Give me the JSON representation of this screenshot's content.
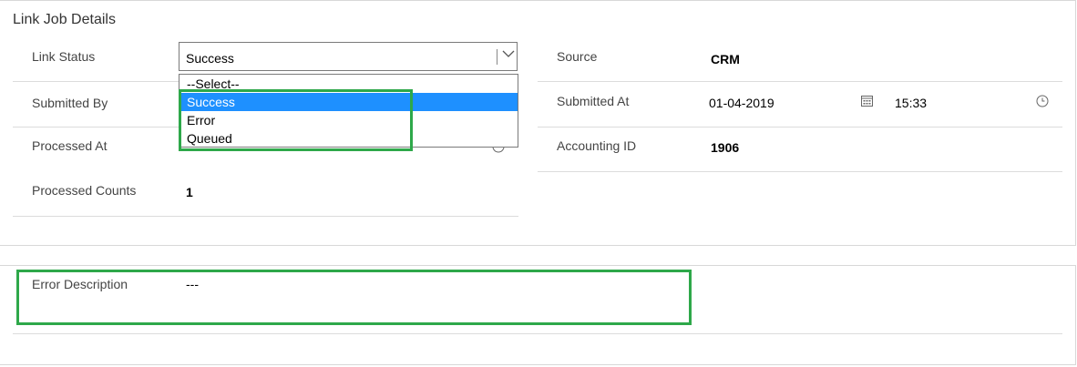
{
  "link_job": {
    "title": "Link Job Details",
    "fields": {
      "link_status": {
        "label": "Link Status",
        "value": "Success"
      },
      "source": {
        "label": "Source",
        "value": "CRM"
      },
      "submitted_by": {
        "label": "Submitted By"
      },
      "submitted_at": {
        "label": "Submitted At",
        "date": "01-04-2019",
        "time": "15:33"
      },
      "processed_at": {
        "label": "Processed At"
      },
      "accounting_id": {
        "label": "Accounting ID",
        "value": "1906"
      },
      "processed_counts": {
        "label": "Processed Counts",
        "value": "1"
      }
    },
    "status_options": [
      "--Select--",
      "Success",
      "Error",
      "Queued"
    ]
  },
  "error_section": {
    "label": "Error Description",
    "value": "---"
  },
  "icons": {
    "dropdown": "chevron-down-icon",
    "date": "calendar-icon",
    "time": "clock-icon"
  },
  "colors": {
    "selected_option": "#1e90ff",
    "highlight": "#2ea84a"
  }
}
